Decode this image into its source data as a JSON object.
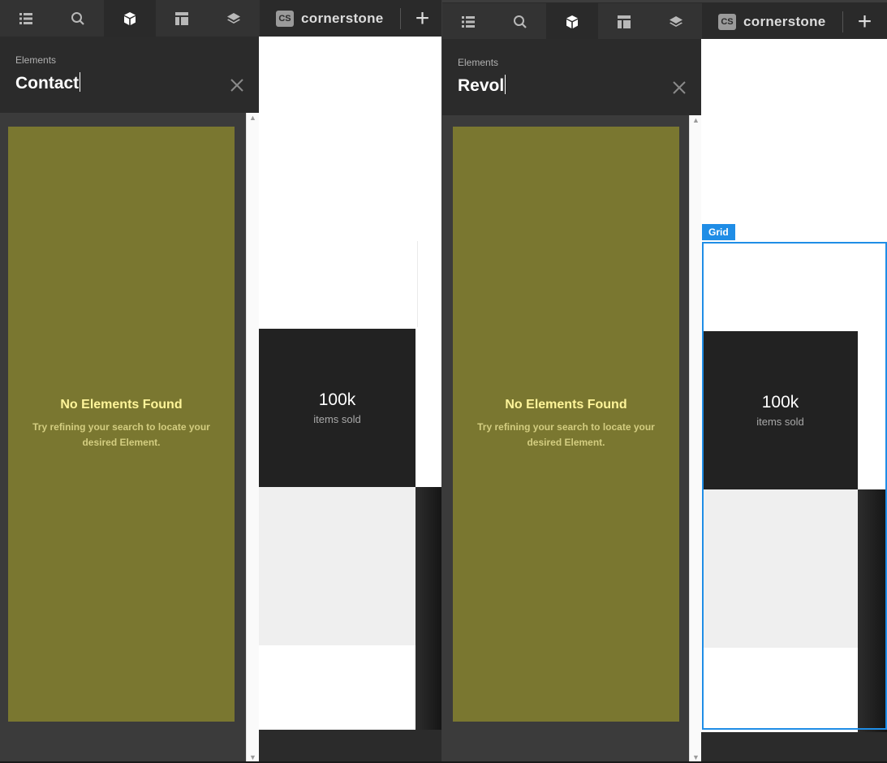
{
  "colors": {
    "empty_bg": "#7a7730",
    "empty_title": "#fff59a",
    "grid_accent": "#1f8de6",
    "toolbar_bg": "#333333"
  },
  "toolbar": {
    "items": [
      {
        "name": "outline",
        "icon": "list-icon"
      },
      {
        "name": "search",
        "icon": "search-icon"
      },
      {
        "name": "elements",
        "icon": "cube-icon",
        "active": true
      },
      {
        "name": "templates",
        "icon": "layout-icon"
      },
      {
        "name": "layers",
        "icon": "layers-icon"
      }
    ],
    "brand_badge": "CS",
    "brand_name": "cornerstone",
    "add_label": "+"
  },
  "panels": [
    {
      "section_label": "Elements",
      "search_value": "Contact",
      "empty_title": "No Elements Found",
      "empty_message": "Try refining your search to locate your desired Element.",
      "stat_value": "100k",
      "stat_label": "items sold"
    },
    {
      "section_label": "Elements",
      "search_value": "Revol",
      "empty_title": "No Elements Found",
      "empty_message": "Try refining your search to locate your desired Element.",
      "stat_value": "100k",
      "stat_label": "items sold",
      "selection_tag": "Grid"
    }
  ]
}
